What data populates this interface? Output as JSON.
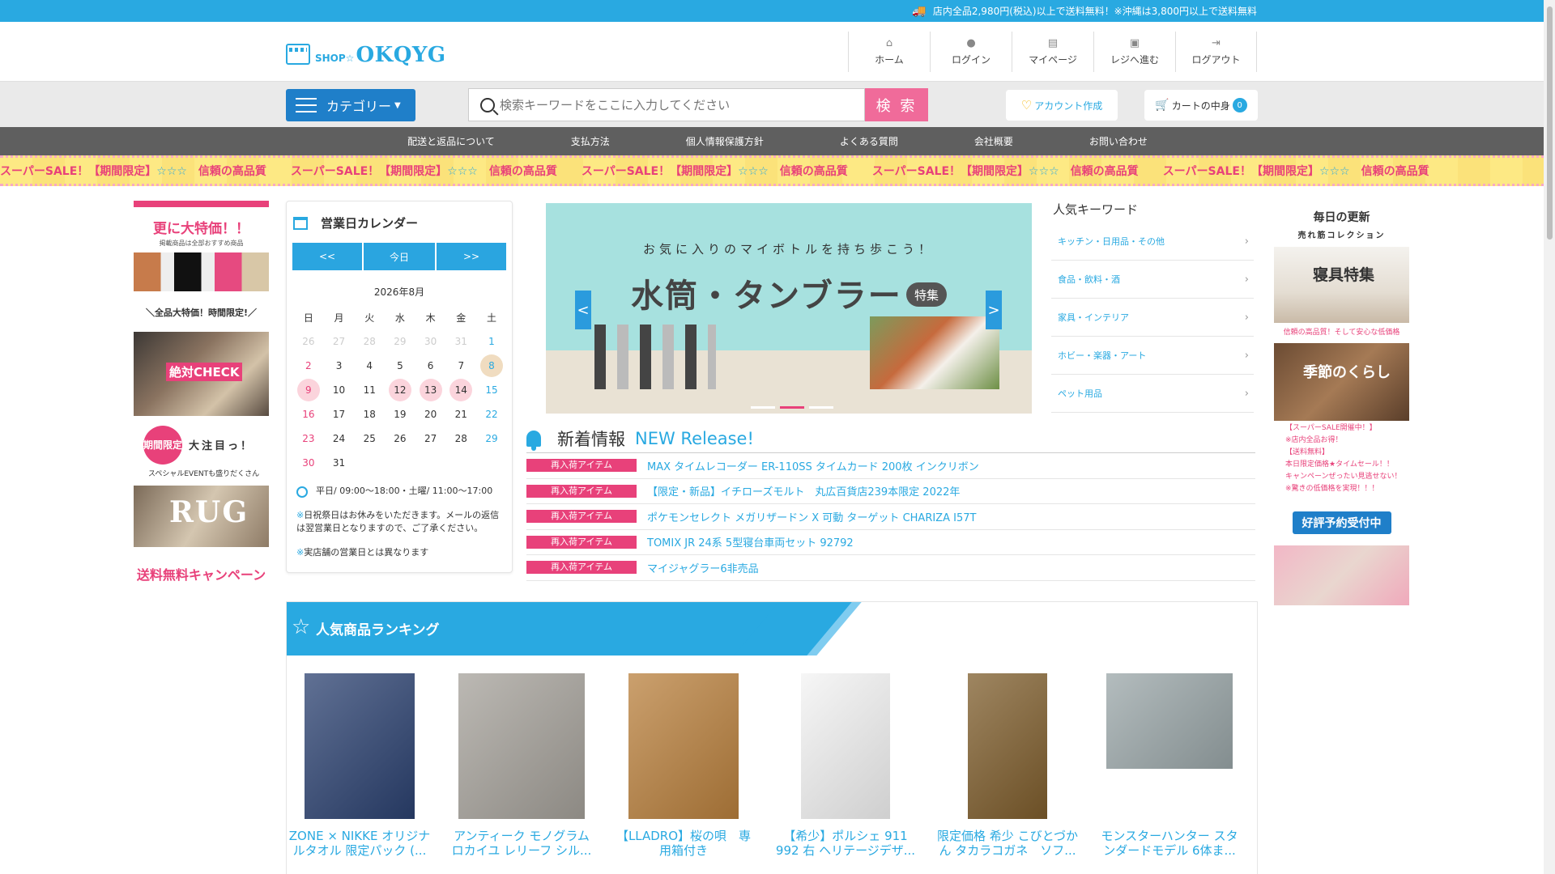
{
  "topbar": {
    "shipping_notice": "店内全品2,980円(税込)以上で送料無料！※沖縄は3,800円以上で送料無料"
  },
  "header": {
    "logo_prefix": "SHOP☆",
    "logo_name": "OKQYG",
    "nav": [
      {
        "label": "ホーム",
        "icon": "home-icon"
      },
      {
        "label": "ログイン",
        "icon": "user-icon"
      },
      {
        "label": "マイページ",
        "icon": "id-card-icon"
      },
      {
        "label": "レジへ進む",
        "icon": "register-icon"
      },
      {
        "label": "ログアウト",
        "icon": "logout-icon"
      }
    ]
  },
  "search": {
    "category_label": "カテゴリー",
    "placeholder": "検索キーワードをここに入力してください",
    "button_label": "検 索",
    "account_label": "アカウント作成",
    "cart_label": "カートの中身",
    "cart_count": "0"
  },
  "global_nav": [
    "配送と返品について",
    "支払方法",
    "個人情報保護方針",
    "よくある質問",
    "会社概要",
    "お問い合わせ"
  ],
  "marquee": {
    "sale": "スーパーSALE！【期間限定】",
    "stars": "☆☆☆",
    "quality": "信頼の高品質"
  },
  "left_banners": {
    "b1_title": "更に大特価！！",
    "b1_sub": "掲載商品は全部おすすめ商品",
    "b2_text": "＼全品大特価！時間限定!／",
    "b3_label": "絶対CHECK",
    "b4_circle": "期間限定",
    "b4_text": "大注目っ！",
    "b4_sub": "スペシャルEVENTも盛りだくさん",
    "b5_text": "RUG",
    "b6_text": "送料無料キャンペーン"
  },
  "calendar": {
    "title": "営業日カレンダー",
    "prev_label": "<<",
    "today_label": "今日",
    "next_label": ">>",
    "month": "2026年8月",
    "weekdays": [
      "日",
      "月",
      "火",
      "水",
      "木",
      "金",
      "土"
    ],
    "days": [
      "26",
      "27",
      "28",
      "29",
      "30",
      "31",
      "1",
      "2",
      "3",
      "4",
      "5",
      "6",
      "7",
      "8",
      "9",
      "10",
      "11",
      "12",
      "13",
      "14",
      "15",
      "16",
      "17",
      "18",
      "19",
      "20",
      "21",
      "22",
      "23",
      "24",
      "25",
      "26",
      "27",
      "28",
      "29",
      "30",
      "31"
    ],
    "hours": "平日/ 09:00～18:00・土曜/ 11:00～17:00",
    "note1": "日祝祭日はお休みをいただきます。メールの返信は翌営業日となりますので、ご了承ください。",
    "note2": "実店舗の営業日とは異なります",
    "mark": "※"
  },
  "hero": {
    "sub": "お気に入りのマイボトルを持ち歩こう！",
    "title": "水筒・タンブラー",
    "tag": "特集",
    "prev": "<",
    "next": ">"
  },
  "keywords": {
    "title": "人気キーワード",
    "items": [
      "キッチン・日用品・その他",
      "食品・飲料・酒",
      "家具・インテリア",
      "ホビー・楽器・アート",
      "ペット用品"
    ]
  },
  "right_col": {
    "title": "毎日の更新",
    "subtitle": "売れ筋コレクション",
    "b1_text": "寝具特集",
    "b1_caption": "信頼の高品質！そして安心な低価格",
    "b2_text": "季節のくらし",
    "b3_lines": [
      "【スーパーSALE開催中！】",
      "※店内全品お得！",
      "【送料無料】",
      "本日限定価格★タイムセール！！",
      "キャンペーンぜったい見逃せない！",
      "※驚きの低価格を実現！！！"
    ],
    "b4_text": "好評予約受付中"
  },
  "news": {
    "title": "新着情報",
    "title_en": "NEW Release!",
    "items": [
      {
        "label": "再入荷アイテム",
        "text": "MAX タイムレコーダー ER-110SS タイムカード 200枚 インクリボン"
      },
      {
        "label": "再入荷アイテム",
        "text": "【限定・新品】イチローズモルト　丸広百貨店239本限定 2022年"
      },
      {
        "label": "再入荷アイテム",
        "text": "ポケモンセレクト メガリザードン X 可動 ターゲット CHARIZA I57T"
      },
      {
        "label": "再入荷アイテム",
        "text": "TOMIX JR 24系 5型寝台車両セット 92792"
      },
      {
        "label": "再入荷アイテム",
        "text": "マイジャグラー6非売品"
      }
    ]
  },
  "ranking": {
    "title": "人気商品ランキング",
    "products": [
      {
        "name": "ZONE × NIKKE オリジナルタオル 限定パック (...",
        "color": "#2b4170"
      },
      {
        "name": "アンティーク モノグラム ロカイユ レリーフ シル...",
        "color": "#a5a19a"
      },
      {
        "name": "【LLADRO】桜の唄　専用箱付き",
        "color": "#b9803d"
      },
      {
        "name": "【希少】ポルシェ 911 992 右 ヘリテージデザ...",
        "color": "#f3f3f3"
      },
      {
        "name": "限定価格 希少 こびとづかん タカラコガネ　ソフ...",
        "color": "#7e5d2c"
      },
      {
        "name": "モンスターハンター スタンダードモデル 6体ま...",
        "color": "#9aa6a8"
      }
    ]
  }
}
